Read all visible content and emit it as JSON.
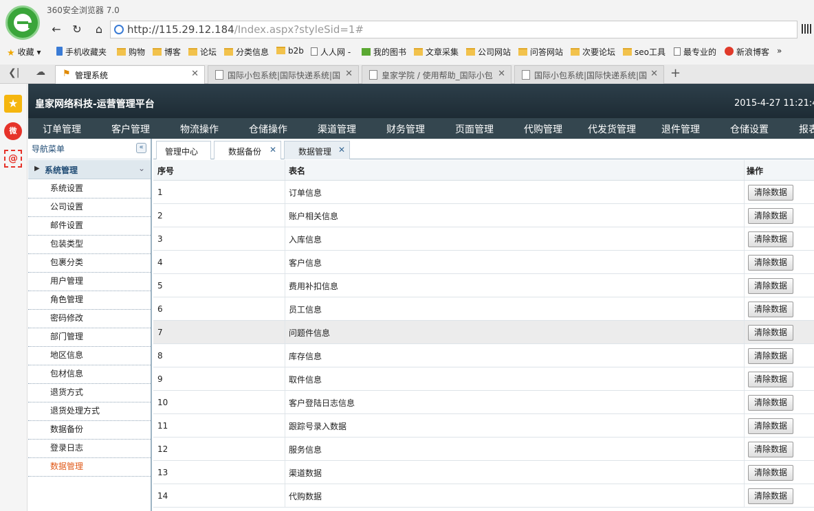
{
  "browser": {
    "title": "360安全浏览器 7.0",
    "url_host": "http://115.29.12.184",
    "url_path": "/Index.aspx?styleSid=1#",
    "bookmarks": [
      "收藏",
      "手机收藏夹",
      "购物",
      "博客",
      "论坛",
      "分类信息",
      "b2b",
      "人人网 -",
      "我的图书",
      "文章采集",
      "公司网站",
      "问答网站",
      "次要论坛",
      "seo工具",
      "最专业的",
      "新浪博客"
    ],
    "tabs": [
      "管理系统",
      "国际小包系统|国际快递系统|国",
      "皇家学院 / 使用帮助_国际小包",
      "国际小包系统|国际快递系统|国"
    ]
  },
  "app": {
    "title": "皇家网络科技-运营管理平台",
    "datetime": "2015-4-27 11:21:4",
    "menu": [
      "订单管理",
      "客户管理",
      "物流操作",
      "仓储操作",
      "渠道管理",
      "财务管理",
      "页面管理",
      "代购管理",
      "代发货管理",
      "退件管理",
      "仓储设置",
      "报表"
    ]
  },
  "nav": {
    "header": "导航菜单",
    "group": "系统管理",
    "items": [
      "系统设置",
      "公司设置",
      "邮件设置",
      "包装类型",
      "包裹分类",
      "用户管理",
      "角色管理",
      "密码修改",
      "部门管理",
      "地区信息",
      "包材信息",
      "退货方式",
      "退货处理方式",
      "数据备份",
      "登录日志",
      "数据管理"
    ],
    "active_item": "数据管理"
  },
  "content_tabs": [
    "管理中心",
    "数据备份",
    "数据管理"
  ],
  "table": {
    "headers": {
      "no": "序号",
      "name": "表名",
      "action": "操作"
    },
    "button_label": "清除数据",
    "rows": [
      {
        "no": "1",
        "name": "订单信息"
      },
      {
        "no": "2",
        "name": "账户相关信息"
      },
      {
        "no": "3",
        "name": "入库信息"
      },
      {
        "no": "4",
        "name": "客户信息"
      },
      {
        "no": "5",
        "name": "费用补扣信息"
      },
      {
        "no": "6",
        "name": "员工信息"
      },
      {
        "no": "7",
        "name": "问题件信息"
      },
      {
        "no": "8",
        "name": "库存信息"
      },
      {
        "no": "9",
        "name": "取件信息"
      },
      {
        "no": "10",
        "name": "客户登陆日志信息"
      },
      {
        "no": "11",
        "name": "跟踪号录入数据"
      },
      {
        "no": "12",
        "name": "服务信息"
      },
      {
        "no": "13",
        "name": "渠道数据"
      },
      {
        "no": "14",
        "name": "代购数据"
      }
    ]
  }
}
